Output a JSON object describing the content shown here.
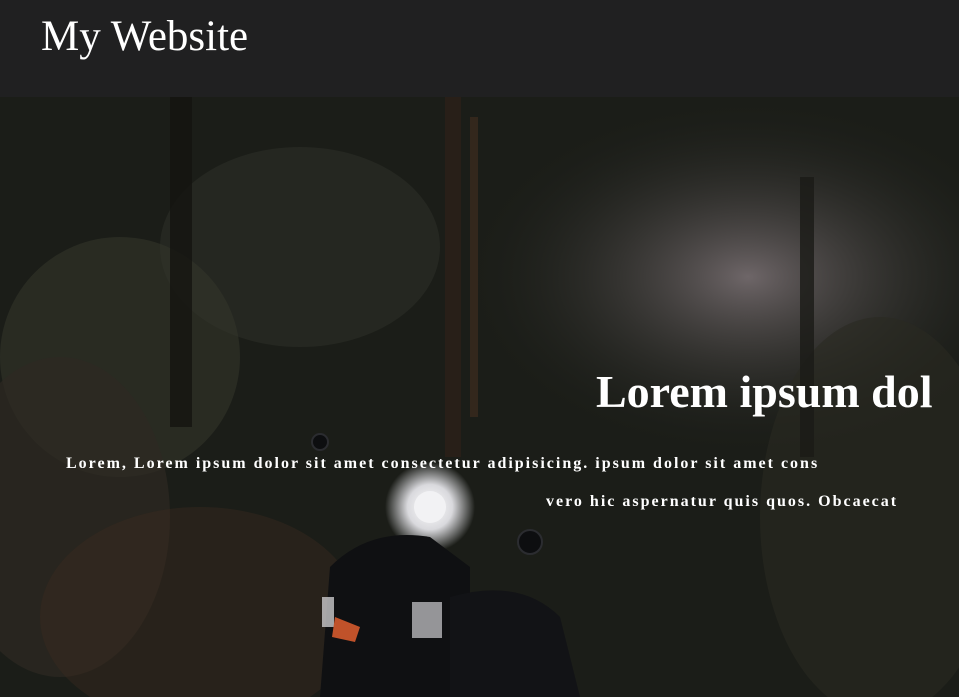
{
  "navbar": {
    "brand": "My Website",
    "background": "#202021"
  },
  "hero": {
    "title": "Lorem ipsum dol",
    "paragraph_lines": [
      "Lorem, Lorem ipsum dolor sit amet consectetur adipisicing. ipsum dolor sit amet cons",
      "vero hic aspernatur quis quos. Obcaecat"
    ],
    "background_image": "forest-scooter-photo",
    "text_color": "#ffffff"
  }
}
